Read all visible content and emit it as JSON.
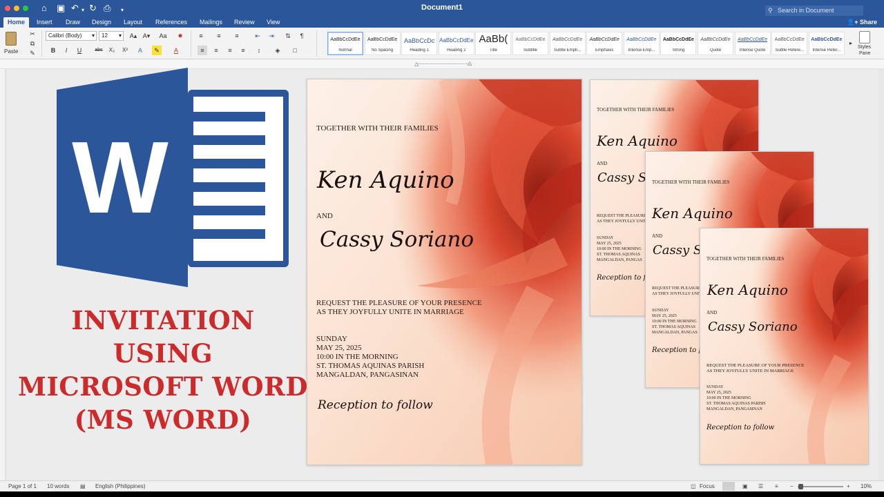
{
  "window": {
    "title": "Document1",
    "search_placeholder": "Search in Document",
    "share_label": "Share"
  },
  "tabs": [
    "Home",
    "Insert",
    "Draw",
    "Design",
    "Layout",
    "References",
    "Mailings",
    "Review",
    "View"
  ],
  "ribbon": {
    "paste_label": "Paste",
    "font_name": "Calibri (Body)",
    "font_size": "12",
    "styles": [
      {
        "sample": "AaBbCcDdEe",
        "name": "Normal"
      },
      {
        "sample": "AaBbCcDdEe",
        "name": "No Spacing"
      },
      {
        "sample": "AaBbCcDc",
        "name": "Heading 1"
      },
      {
        "sample": "AaBbCcDdEe",
        "name": "Heading 2"
      },
      {
        "sample": "AaBb(",
        "name": "Title"
      },
      {
        "sample": "AaBbCcDdEe",
        "name": "Subtitle"
      },
      {
        "sample": "AaBbCcDdEe",
        "name": "Subtle Emph..."
      },
      {
        "sample": "AaBbCcDdEe",
        "name": "Emphasis"
      },
      {
        "sample": "AaBbCcDdEe",
        "name": "Intense Emp..."
      },
      {
        "sample": "AaBbCcDdEe",
        "name": "Strong"
      },
      {
        "sample": "AaBbCcDdEe",
        "name": "Quote"
      },
      {
        "sample": "AaBbCcDdEe",
        "name": "Intense Quote"
      },
      {
        "sample": "AaBbCcDdEe",
        "name": "Subtle Refere..."
      },
      {
        "sample": "AaBbCcDdEe",
        "name": "Intense Refer..."
      }
    ],
    "styles_pane_line1": "Styles",
    "styles_pane_line2": "Pane"
  },
  "logo": {
    "letter": "W"
  },
  "promo": {
    "line1": "INVITATION",
    "line2": "USING",
    "line3": "MICROSOFT WORD",
    "line4": "(MS WORD)"
  },
  "invitation": {
    "header": "TOGETHER WITH THEIR FAMILIES",
    "name1": "Ken Aquino",
    "and": "AND",
    "name2": "Cassy Soriano",
    "request1": "REQUEST THE PLEASURE OF YOUR PRESENCE",
    "request2": "AS THEY JOYFULLY UNITE IN MARRIAGE",
    "day": "SUNDAY",
    "date": "MAY 25, 2025",
    "time": "10:00 IN THE MORNING",
    "venue": "ST. THOMAS AQUINAS PARISH",
    "place": "MANGALDAN, PANGASINAN",
    "reception": "Reception to follow",
    "name2_partial": "Cassy So",
    "reception_partial": "Reception to follo",
    "request1_partial": "REQUEST THE PLEASURE O",
    "request2_partial": "AS THEY JOYFULLY UNITE",
    "time_partial": "10:00 IN THE MORNING",
    "venue_partial": "ST. THOMAS AQUINAS",
    "place_partial": "MANGALDAN, PANGAS"
  },
  "status": {
    "page": "Page 1 of 1",
    "words": "10 words",
    "language": "English (Philippines)",
    "focus": "Focus",
    "zoom": "10%"
  },
  "colors": {
    "word_blue": "#2b579a",
    "title_red": "#cc2b2b"
  }
}
